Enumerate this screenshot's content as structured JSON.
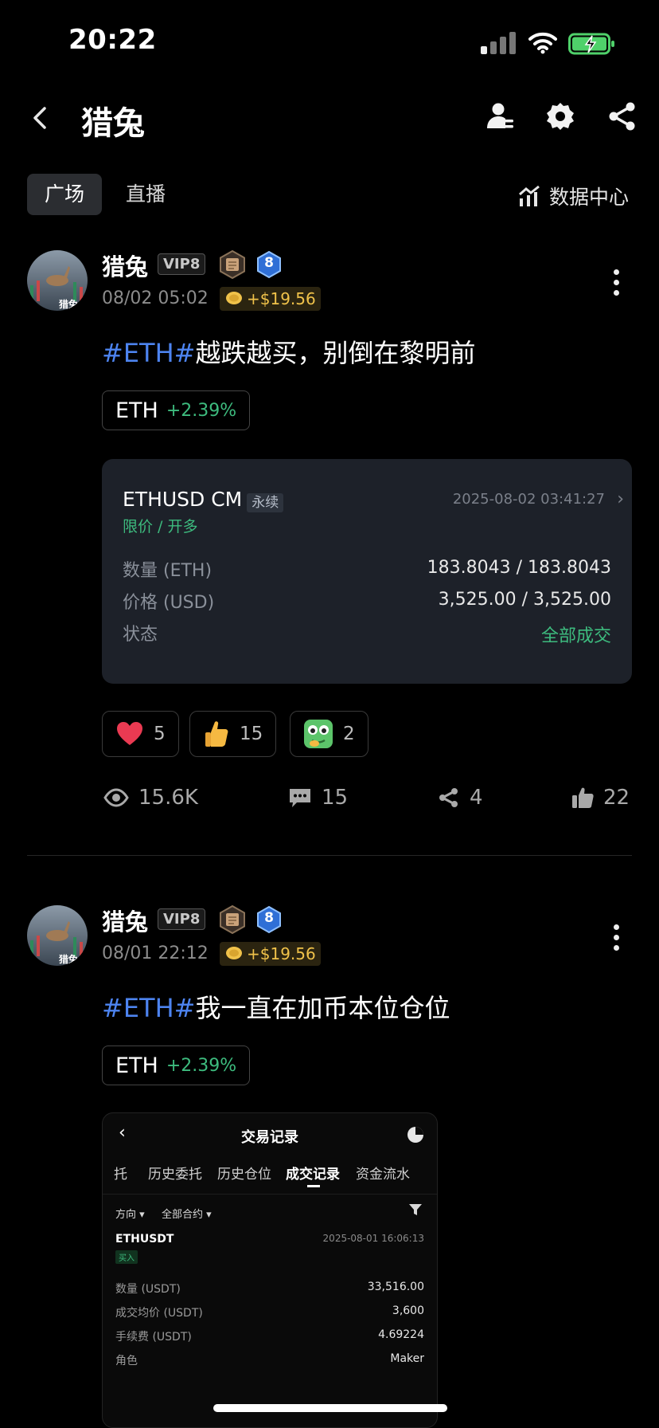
{
  "status_bar": {
    "time": "20:22"
  },
  "header": {
    "title": "猎兔"
  },
  "tabs": [
    {
      "label": "广场"
    },
    {
      "label": "直播"
    }
  ],
  "data_center": {
    "label": "数据中心"
  },
  "posts": [
    {
      "author": "猎兔",
      "vip": "VIP8",
      "level_badge": "8",
      "time": "08/02 05:02",
      "profit": "+$19.56",
      "hashtag": "#ETH#",
      "text": "越跌越买，别倒在黎明前",
      "coin_chip": {
        "symbol": "ETH",
        "change": "+2.39%"
      },
      "order": {
        "symbol": "ETHUSD CM",
        "contract": "永续",
        "datetime": "2025-08-02 03:41:27",
        "type": "限价 / 开多",
        "rows": [
          {
            "label": "数量 (ETH)",
            "value": "183.8043 / 183.8043"
          },
          {
            "label": "价格 (USD)",
            "value": "3,525.00 / 3,525.00"
          },
          {
            "label": "状态",
            "value": "全部成交"
          }
        ]
      },
      "reactions": [
        {
          "icon": "heart-icon",
          "count": "5"
        },
        {
          "icon": "thumbs-up-emoji-icon",
          "count": "15"
        },
        {
          "icon": "frog-emoji-icon",
          "count": "2"
        }
      ],
      "stats": {
        "views": "15.6K",
        "comments": "15",
        "shares": "4",
        "likes": "22"
      }
    },
    {
      "author": "猎兔",
      "vip": "VIP8",
      "level_badge": "8",
      "time": "08/01 22:12",
      "profit": "+$19.56",
      "hashtag": "#ETH#",
      "text": "我一直在加币本位仓位",
      "coin_chip": {
        "symbol": "ETH",
        "change": "+2.39%"
      },
      "trade_screenshot": {
        "title": "交易记录",
        "tabs": [
          "‌托",
          "历史委托",
          "历史仓位",
          "成交记录",
          "资金流水"
        ],
        "active_tab": "成交记录",
        "filters": [
          "方向 ▾",
          "全部合约 ▾"
        ],
        "symbol": "ETHUSDT",
        "datetime": "2025-08-01 16:06:13",
        "side": "买入",
        "rows": [
          {
            "label": "数量 (USDT)",
            "value": "33,516.00"
          },
          {
            "label": "成交均价 (USDT)",
            "value": "3,600"
          },
          {
            "label": "手续费 (USDT)",
            "value": "4.69224"
          },
          {
            "label": "角色",
            "value": "Maker"
          }
        ]
      }
    }
  ],
  "colors": {
    "background": "#000000",
    "hashtag": "#4D84F0",
    "positive": "#3DBB7E",
    "profit": "#F0C24A",
    "card": "#1D2129"
  }
}
